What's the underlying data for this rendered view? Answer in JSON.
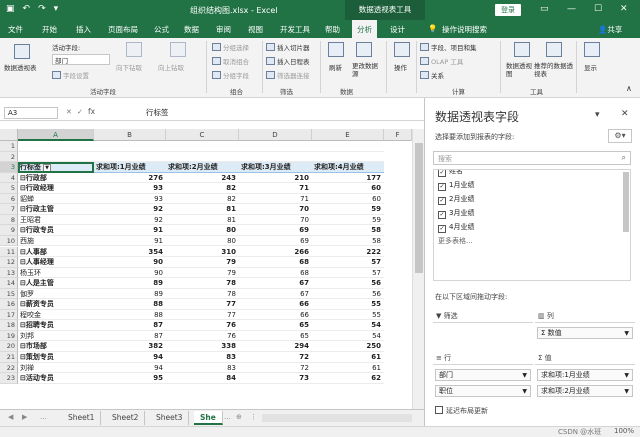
{
  "titlebar": {
    "title": "组织结构图.xlsx  -  Excel",
    "context_tab": "数据透视表工具",
    "login": "登录"
  },
  "tabs": [
    "文件",
    "开始",
    "插入",
    "页面布局",
    "公式",
    "数据",
    "审阅",
    "视图",
    "开发工具",
    "帮助",
    "分析",
    "设计"
  ],
  "active_tab": "分析",
  "tell_me": "操作说明搜索",
  "share": "共享",
  "ribbon": {
    "pivot_table": "数据透视表",
    "active_field_label": "活动字段:",
    "active_field_value": "部门",
    "field_settings": "字段设置",
    "drill_down": "向下钻取",
    "drill_up": "向上钻取",
    "group_selection": "分组选择",
    "ungroup": "取消组合",
    "group_field": "分组字段",
    "insert_slicer": "插入切片器",
    "insert_timeline": "插入日程表",
    "filter_connections": "筛选器连接",
    "refresh": "刷新",
    "change_source": "更改数据源",
    "actions": "操作",
    "fields_items": "字段、项目和集",
    "olap_tools": "OLAP 工具",
    "relationships": "关系",
    "pivot_chart": "数据透视图",
    "recommended": "推荐的数据透视表",
    "show": "显示",
    "groups": {
      "active_field": "活动字段",
      "group": "组合",
      "filter": "筛选",
      "data": "数据",
      "calculations": "计算",
      "tools": "工具"
    }
  },
  "formula_bar": {
    "name_box": "A3",
    "fx": "fx",
    "value": "行标签"
  },
  "columns": [
    "A",
    "B",
    "C",
    "D",
    "E",
    "F"
  ],
  "rows": [
    {
      "n": "1",
      "a": "",
      "v": [
        "",
        "",
        "",
        ""
      ],
      "t": "blank"
    },
    {
      "n": "2",
      "a": "",
      "v": [
        "",
        "",
        "",
        ""
      ],
      "t": "blank"
    },
    {
      "n": "3",
      "a": "行标签",
      "v": [
        "求和项:1月业绩",
        "求和项:2月业绩",
        "求和项:3月业绩",
        "求和项:4月业绩"
      ],
      "t": "header"
    },
    {
      "n": "4",
      "a": "⊟行政部",
      "v": [
        "276",
        "243",
        "210",
        "177"
      ],
      "t": "dept"
    },
    {
      "n": "5",
      "a": "  ⊟行政经理",
      "v": [
        "93",
        "82",
        "71",
        "60"
      ],
      "t": "pos"
    },
    {
      "n": "6",
      "a": "      貂蝉",
      "v": [
        "93",
        "82",
        "71",
        "60"
      ],
      "t": "name"
    },
    {
      "n": "7",
      "a": "  ⊟行政主管",
      "v": [
        "92",
        "81",
        "70",
        "59"
      ],
      "t": "pos"
    },
    {
      "n": "8",
      "a": "      王昭君",
      "v": [
        "92",
        "81",
        "70",
        "59"
      ],
      "t": "name"
    },
    {
      "n": "9",
      "a": "  ⊟行政专员",
      "v": [
        "91",
        "80",
        "69",
        "58"
      ],
      "t": "pos"
    },
    {
      "n": "10",
      "a": "      西施",
      "v": [
        "91",
        "80",
        "69",
        "58"
      ],
      "t": "name"
    },
    {
      "n": "11",
      "a": "⊟人事部",
      "v": [
        "354",
        "310",
        "266",
        "222"
      ],
      "t": "dept"
    },
    {
      "n": "12",
      "a": "  ⊟人事经理",
      "v": [
        "90",
        "79",
        "68",
        "57"
      ],
      "t": "pos"
    },
    {
      "n": "13",
      "a": "      杨玉环",
      "v": [
        "90",
        "79",
        "68",
        "57"
      ],
      "t": "name"
    },
    {
      "n": "14",
      "a": "  ⊟人是主管",
      "v": [
        "89",
        "78",
        "67",
        "56"
      ],
      "t": "pos"
    },
    {
      "n": "15",
      "a": "      伽罗",
      "v": [
        "89",
        "78",
        "67",
        "56"
      ],
      "t": "name"
    },
    {
      "n": "16",
      "a": "  ⊟薪资专员",
      "v": [
        "88",
        "77",
        "66",
        "55"
      ],
      "t": "pos"
    },
    {
      "n": "17",
      "a": "      程咬金",
      "v": [
        "88",
        "77",
        "66",
        "55"
      ],
      "t": "name"
    },
    {
      "n": "18",
      "a": "  ⊟招聘专员",
      "v": [
        "87",
        "76",
        "65",
        "54"
      ],
      "t": "pos"
    },
    {
      "n": "19",
      "a": "      刘邦",
      "v": [
        "87",
        "76",
        "65",
        "54"
      ],
      "t": "name"
    },
    {
      "n": "20",
      "a": "⊟市场部",
      "v": [
        "382",
        "338",
        "294",
        "250"
      ],
      "t": "dept"
    },
    {
      "n": "21",
      "a": "  ⊟策划专员",
      "v": [
        "94",
        "83",
        "72",
        "61"
      ],
      "t": "pos"
    },
    {
      "n": "22",
      "a": "      刘禅",
      "v": [
        "94",
        "83",
        "72",
        "61"
      ],
      "t": "name"
    },
    {
      "n": "23",
      "a": "  ⊟活动专员",
      "v": [
        "95",
        "84",
        "73",
        "62"
      ],
      "t": "pos"
    }
  ],
  "sheets": [
    "Sheet1",
    "Sheet2",
    "Sheet3",
    "She"
  ],
  "active_sheet": "She",
  "pane": {
    "title": "数据透视表字段",
    "subtitle": "选择要添加到报表的字段:",
    "search_placeholder": "搜索",
    "fields": [
      {
        "label": "姓名",
        "checked": true
      },
      {
        "label": "1月业绩",
        "checked": true
      },
      {
        "label": "2月业绩",
        "checked": true
      },
      {
        "label": "3月业绩",
        "checked": true
      },
      {
        "label": "4月业绩",
        "checked": true
      },
      {
        "label": "更多表格...",
        "checked": false
      }
    ],
    "drag_hint": "在以下区域间拖动字段:",
    "filters_label": "筛选",
    "columns_label": "列",
    "columns_item": "Σ 数值",
    "rows_label": "行",
    "rows_items": [
      "部门",
      "职位"
    ],
    "values_label": "值",
    "values_items": [
      "求和项:1月业绩",
      "求和项:2月业绩"
    ],
    "defer": "延迟布局更新"
  },
  "watermark": "CSDN @水班",
  "zoom": "100%"
}
